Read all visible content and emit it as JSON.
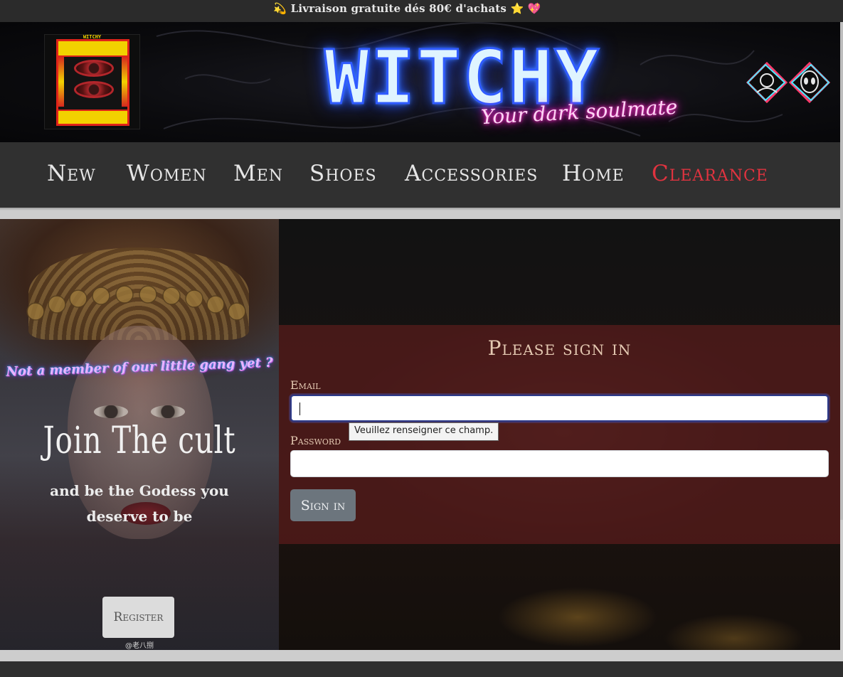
{
  "topbar": {
    "announcement": "💫 Livraison gratuite dés 80€ d'achats ⭐ 💖"
  },
  "header": {
    "logo_text": "WITCHY",
    "brand": "WITCHY",
    "tagline": "Your dark soulmate"
  },
  "nav": {
    "items": [
      {
        "label": "New"
      },
      {
        "label": "Women"
      },
      {
        "label": "Men"
      },
      {
        "label": "Shoes"
      },
      {
        "label": "Accessories"
      },
      {
        "label": "Home"
      },
      {
        "label": "Clearance"
      }
    ]
  },
  "promo": {
    "not_member": "Not a member of our little gang yet ?",
    "join": "Join The cult",
    "subtitle": "and be the Godess you deserve to be",
    "register_label": "Register",
    "watermark": "@老八捌"
  },
  "signin": {
    "title": "Please sign in",
    "email_label": "Email",
    "email_value": "",
    "password_label": "Password",
    "password_value": "",
    "button_label": "Sign in",
    "tooltip": "Veuillez renseigner ce champ."
  },
  "colors": {
    "neon_blue": "#2f5bff",
    "neon_pink": "#ff2fc8",
    "clearance": "#e0333f",
    "panel": "#5a1c1c",
    "button": "#6c757d"
  }
}
